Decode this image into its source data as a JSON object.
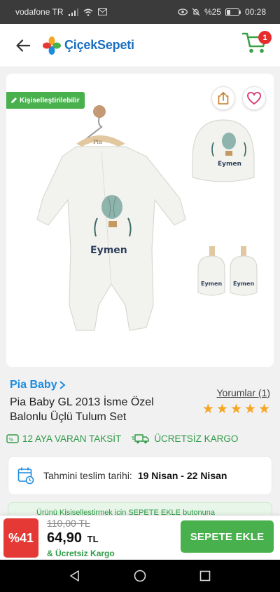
{
  "status_bar": {
    "carrier": "vodafone TR",
    "battery": "%25",
    "time": "00:28"
  },
  "header": {
    "logo_text": "ÇiçekSepeti",
    "cart_count": "1"
  },
  "product": {
    "badge": "Kişiselleştirilebilir",
    "image_texts": {
      "hanger_tag": "Pia",
      "name_print": "Eymen"
    },
    "brand": "Pia Baby",
    "title": "Pia Baby GL 2013 İsme Özel Balonlu Üçlü Tulum Set",
    "reviews_label": "Yorumlar (1)",
    "rating_stars": 5,
    "features": {
      "installment": "12 AYA VARAN TAKSİT",
      "free_shipping": "ÜCRETSİZ KARGO"
    },
    "delivery": {
      "label": "Tahmini teslim tarihi:",
      "value": "19 Nisan - 22 Nisan"
    },
    "info_strip_text": "Ürünü Kişiselleştirmek için SEPETE EKLE butonuna"
  },
  "buy_bar": {
    "discount": "%41",
    "old_price": "110,00 TL",
    "new_price": "64,90",
    "currency": "TL",
    "shipping_note": "& Ücretsiz Kargo",
    "add_to_cart": "SEPETE EKLE"
  },
  "colors": {
    "brand_green": "#48b04c",
    "brand_blue": "#1b8ce0",
    "discount_red": "#e53935",
    "star": "#f5a623"
  },
  "icons": {
    "back": "arrow-left-icon",
    "share": "share-icon",
    "favorite": "heart-icon",
    "cart": "cart-icon",
    "calendar": "calendar-icon",
    "truck": "truck-icon",
    "installment": "card-icon"
  }
}
